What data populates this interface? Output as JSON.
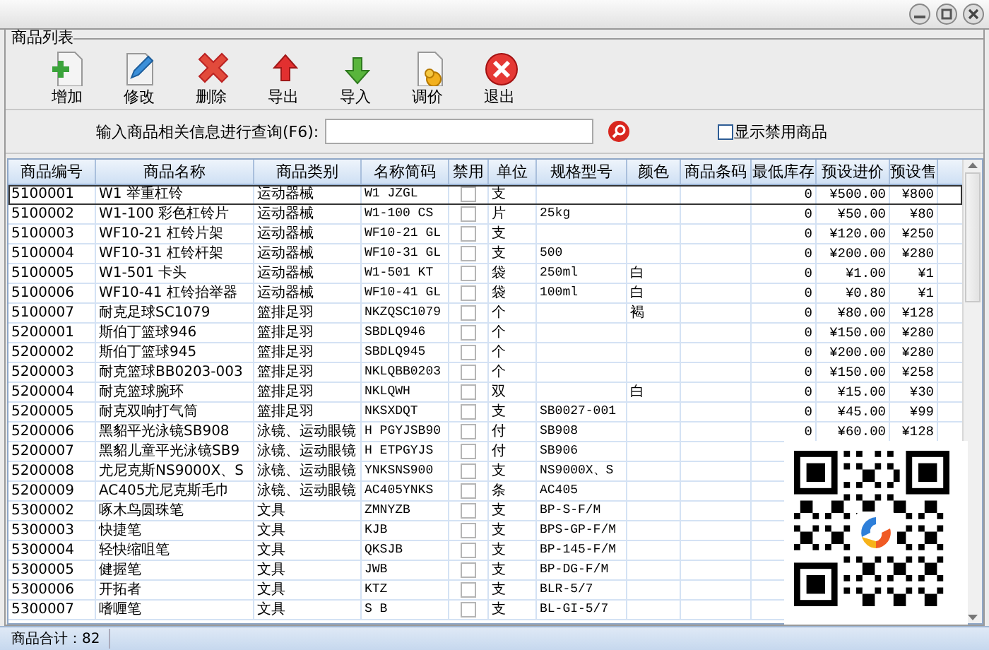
{
  "group_title": "商品列表",
  "toolbar": [
    {
      "kind": "add",
      "label": "增加"
    },
    {
      "kind": "edit",
      "label": "修改"
    },
    {
      "kind": "delete",
      "label": "删除"
    },
    {
      "kind": "export",
      "label": "导出"
    },
    {
      "kind": "import",
      "label": "导入"
    },
    {
      "kind": "price",
      "label": "调价"
    },
    {
      "kind": "exit",
      "label": "退出"
    }
  ],
  "search": {
    "label": "输入商品相关信息进行查询(F6):",
    "show_disabled": {
      "label": "显示禁用商品",
      "checked": false
    }
  },
  "table": {
    "columns": [
      "商品编号",
      "商品名称",
      "商品类别",
      "名称简码",
      "禁用",
      "单位",
      "规格型号",
      "颜色",
      "商品条码",
      "最低库存",
      "预设进价",
      "预设售"
    ],
    "rows": [
      {
        "selected": true,
        "code": "5100001",
        "name": "W1 举重杠铃",
        "category": "运动器械",
        "short_code": "W1 JZGL",
        "disabled": false,
        "unit": "支",
        "min_stock": "0",
        "cost_price": "¥500.00",
        "sale_price": "¥800"
      },
      {
        "selected": false,
        "code": "5100002",
        "name": "W1-100 彩色杠铃片",
        "category": "运动器械",
        "short_code": "W1-100 CS",
        "disabled": false,
        "unit": "片",
        "spec": "25kg",
        "min_stock": "0",
        "cost_price": "¥50.00",
        "sale_price": "¥80"
      },
      {
        "selected": false,
        "code": "5100003",
        "name": "WF10-21 杠铃片架",
        "category": "运动器械",
        "short_code": "WF10-21 GL",
        "disabled": false,
        "unit": "支",
        "min_stock": "0",
        "cost_price": "¥120.00",
        "sale_price": "¥250"
      },
      {
        "selected": false,
        "code": "5100004",
        "name": "WF10-31 杠铃杆架",
        "category": "运动器械",
        "short_code": "WF10-31 GL",
        "disabled": false,
        "unit": "支",
        "spec": "500",
        "min_stock": "0",
        "cost_price": "¥200.00",
        "sale_price": "¥280"
      },
      {
        "selected": false,
        "code": "5100005",
        "name": "W1-501 卡头",
        "category": "运动器械",
        "short_code": "W1-501 KT",
        "disabled": false,
        "unit": "袋",
        "spec": "250ml",
        "color_label": "白",
        "min_stock": "0",
        "cost_price": "¥1.00",
        "sale_price": "¥1"
      },
      {
        "selected": false,
        "code": "5100006",
        "name": "WF10-41 杠铃抬举器",
        "category": "运动器械",
        "short_code": "WF10-41 GL",
        "disabled": false,
        "unit": "袋",
        "spec": "100ml",
        "color_label": "白",
        "min_stock": "0",
        "cost_price": "¥0.80",
        "sale_price": "¥1"
      },
      {
        "selected": false,
        "code": "5100007",
        "name": "耐克足球SC1079",
        "category": "篮排足羽",
        "short_code": "NKZQSC1079",
        "disabled": false,
        "unit": "个",
        "color_label": "褐",
        "min_stock": "0",
        "cost_price": "¥80.00",
        "sale_price": "¥128"
      },
      {
        "selected": false,
        "code": "5200001",
        "name": "斯伯丁篮球946",
        "category": "篮排足羽",
        "short_code": "SBDLQ946",
        "disabled": false,
        "unit": "个",
        "min_stock": "0",
        "cost_price": "¥150.00",
        "sale_price": "¥280"
      },
      {
        "selected": false,
        "code": "5200002",
        "name": "斯伯丁篮球945",
        "category": "篮排足羽",
        "short_code": "SBDLQ945",
        "disabled": false,
        "unit": "个",
        "min_stock": "0",
        "cost_price": "¥200.00",
        "sale_price": "¥280"
      },
      {
        "selected": false,
        "code": "5200003",
        "name": "耐克篮球BB0203-003",
        "category": "篮排足羽",
        "short_code": "NKLQBB0203",
        "disabled": false,
        "unit": "个",
        "min_stock": "0",
        "cost_price": "¥150.00",
        "sale_price": "¥258"
      },
      {
        "selected": false,
        "code": "5200004",
        "name": "耐克篮球腕环",
        "category": "篮排足羽",
        "short_code": "NKLQWH",
        "disabled": false,
        "unit": "双",
        "color_label": "白",
        "min_stock": "0",
        "cost_price": "¥15.00",
        "sale_price": "¥30"
      },
      {
        "selected": false,
        "code": "5200005",
        "name": "耐克双响打气筒",
        "category": "篮排足羽",
        "short_code": "NKSXDQT",
        "disabled": false,
        "unit": "支",
        "spec": "SB0027-001",
        "min_stock": "0",
        "cost_price": "¥45.00",
        "sale_price": "¥99"
      },
      {
        "selected": false,
        "code": "5200006",
        "name": "黑貂平光泳镜SB908",
        "category": "泳镜、运动眼镜",
        "short_code": "H PGYJSB90",
        "disabled": false,
        "unit": "付",
        "spec": "SB908",
        "min_stock": "0",
        "cost_price": "¥60.00",
        "sale_price": "¥128"
      },
      {
        "selected": false,
        "code": "5200007",
        "name": "黑貂儿童平光泳镜SB9",
        "category": "泳镜、运动眼镜",
        "short_code": "H ETPGYJS",
        "disabled": false,
        "unit": "付",
        "spec": "SB906"
      },
      {
        "selected": false,
        "code": "5200008",
        "name": "尤尼克斯NS9000X、S",
        "category": "泳镜、运动眼镜",
        "short_code": "YNKSNS900",
        "disabled": false,
        "unit": "支",
        "spec": "NS9000X、S"
      },
      {
        "selected": false,
        "code": "5200009",
        "name": "AC405尤尼克斯毛巾",
        "category": "泳镜、运动眼镜",
        "short_code": "AC405YNKS",
        "disabled": false,
        "unit": "条",
        "spec": "AC405"
      },
      {
        "selected": false,
        "code": "5300002",
        "name": "啄木鸟圆珠笔",
        "category": "文具",
        "short_code": "ZMNYZB",
        "disabled": false,
        "unit": "支",
        "spec": "BP-S-F/M"
      },
      {
        "selected": false,
        "code": "5300003",
        "name": "快捷笔",
        "category": "文具",
        "short_code": "KJB",
        "disabled": false,
        "unit": "支",
        "spec": "BPS-GP-F/M"
      },
      {
        "selected": false,
        "code": "5300004",
        "name": "轻快缩咀笔",
        "category": "文具",
        "short_code": "QKSJB",
        "disabled": false,
        "unit": "支",
        "spec": "BP-145-F/M"
      },
      {
        "selected": false,
        "code": "5300005",
        "name": "健握笔",
        "category": "文具",
        "short_code": "JWB",
        "disabled": false,
        "unit": "支",
        "spec": "BP-DG-F/M"
      },
      {
        "selected": false,
        "code": "5300006",
        "name": "开拓者",
        "category": "文具",
        "short_code": "KTZ",
        "disabled": false,
        "unit": "支",
        "spec": "BLR-5/7"
      },
      {
        "selected": false,
        "code": "5300007",
        "name": "嗜喱笔",
        "category": "文具",
        "short_code": "S B",
        "disabled": false,
        "unit": "支",
        "spec": "BL-GI-5/7"
      }
    ]
  },
  "status_bar": {
    "total": "商品合计：82"
  }
}
